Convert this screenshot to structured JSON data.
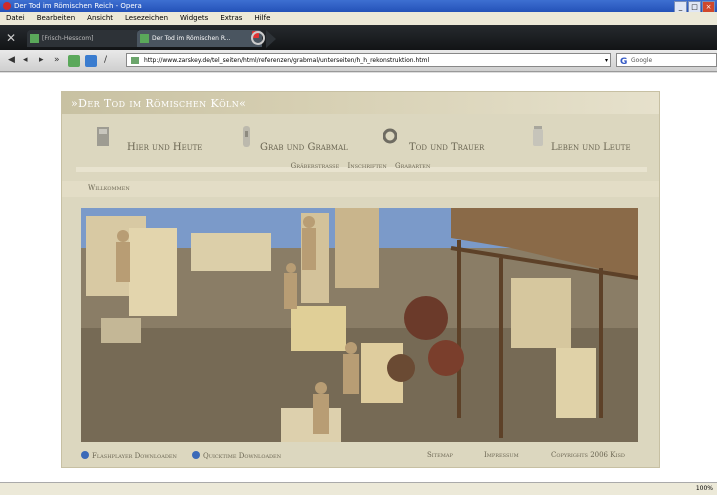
{
  "window": {
    "title": "Der Tod im Römischen Reich - Opera"
  },
  "menu": {
    "items": [
      "Datei",
      "Bearbeiten",
      "Ansicht",
      "Lesezeichen",
      "Widgets",
      "Extras",
      "Hilfe"
    ]
  },
  "tabs": [
    {
      "label": "[Frisch-Hesscom]"
    },
    {
      "label": "Der Tod im Römischen R..."
    }
  ],
  "address": {
    "url": "http://www.zarskey.de/tel_seiten/html/referenzen/grabmal/unterseiten/h_h_rekonstruktion.html",
    "search_engine": "Google"
  },
  "status": {
    "zoom": "100%"
  },
  "page": {
    "site_title": "»Der Tod im Römischen Köln«",
    "nav": [
      {
        "label": "Hier und Heute",
        "icon": "monument-icon"
      },
      {
        "label": "Grab und Grabmal",
        "icon": "tombstone-icon"
      },
      {
        "label": "Tod und Trauer",
        "icon": "wreath-icon"
      },
      {
        "label": "Leben und Leute",
        "icon": "urn-icon"
      }
    ],
    "subnav": [
      "Gräberstrasse",
      "Inschriften",
      "Grabarten"
    ],
    "welcome": "Willkommen",
    "footer": {
      "flash": "Flashplayer Downloaden",
      "quicktime": "Quicktime Downloaden",
      "sitemap": "Sitemap",
      "impressum": "Impressum",
      "copyright": "Copyrights 2006 Kisd"
    }
  }
}
